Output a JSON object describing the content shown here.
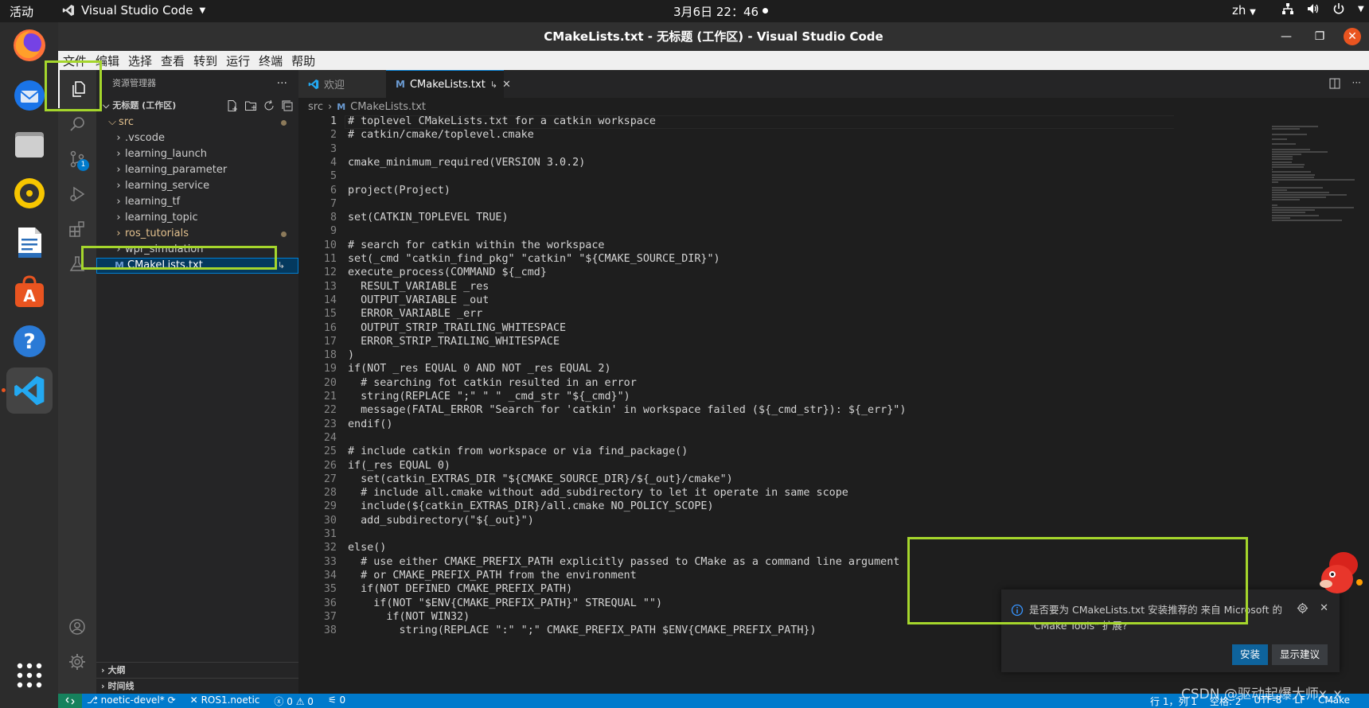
{
  "topbar": {
    "activities": "活动",
    "app_name": "Visual Studio Code",
    "clock": "3月6日  22：46",
    "lang": "zh"
  },
  "window": {
    "title": "CMakeLists.txt - 无标题 (工作区) - Visual Studio Code"
  },
  "menu": [
    "文件",
    "编辑",
    "选择",
    "查看",
    "转到",
    "运行",
    "终端",
    "帮助"
  ],
  "activity_bar": {
    "scm_badge": "1"
  },
  "sidebar": {
    "header": "资源管理器",
    "more": "···",
    "workspace": "无标题 (工作区)",
    "root_folder": "src",
    "items": [
      {
        "label": "src",
        "type": "folder",
        "color": "#e2c08d"
      },
      {
        "label": ".vscode",
        "type": "folder",
        "color": "#cccccc"
      },
      {
        "label": "learning_launch",
        "type": "folder",
        "color": "#cccccc"
      },
      {
        "label": "learning_parameter",
        "type": "folder",
        "color": "#cccccc"
      },
      {
        "label": "learning_service",
        "type": "folder",
        "color": "#cccccc"
      },
      {
        "label": "learning_tf",
        "type": "folder",
        "color": "#cccccc"
      },
      {
        "label": "learning_topic",
        "type": "folder",
        "color": "#cccccc"
      },
      {
        "label": "ros_tutorials",
        "type": "folder",
        "color": "#e2c08d"
      },
      {
        "label": "wpr_simulation",
        "type": "folder",
        "color": "#cccccc"
      },
      {
        "label": "CMakeLists.txt",
        "type": "file",
        "color": "#ffffff"
      }
    ],
    "outline": "大纲",
    "timeline": "时间线"
  },
  "tabs": [
    {
      "label": "欢迎"
    },
    {
      "label": "CMakeLists.txt"
    }
  ],
  "breadcrumb": {
    "folder": "src",
    "file": "CMakeLists.txt"
  },
  "code_lines": [
    "# toplevel CMakeLists.txt for a catkin workspace",
    "# catkin/cmake/toplevel.cmake",
    "",
    "cmake_minimum_required(VERSION 3.0.2)",
    "",
    "project(Project)",
    "",
    "set(CATKIN_TOPLEVEL TRUE)",
    "",
    "# search for catkin within the workspace",
    "set(_cmd \"catkin_find_pkg\" \"catkin\" \"${CMAKE_SOURCE_DIR}\")",
    "execute_process(COMMAND ${_cmd}",
    "  RESULT_VARIABLE _res",
    "  OUTPUT_VARIABLE _out",
    "  ERROR_VARIABLE _err",
    "  OUTPUT_STRIP_TRAILING_WHITESPACE",
    "  ERROR_STRIP_TRAILING_WHITESPACE",
    ")",
    "if(NOT _res EQUAL 0 AND NOT _res EQUAL 2)",
    "  # searching fot catkin resulted in an error",
    "  string(REPLACE \";\" \" \" _cmd_str \"${_cmd}\")",
    "  message(FATAL_ERROR \"Search for 'catkin' in workspace failed (${_cmd_str}): ${_err}\")",
    "endif()",
    "",
    "# include catkin from workspace or via find_package()",
    "if(_res EQUAL 0)",
    "  set(catkin_EXTRAS_DIR \"${CMAKE_SOURCE_DIR}/${_out}/cmake\")",
    "  # include all.cmake without add_subdirectory to let it operate in same scope",
    "  include(${catkin_EXTRAS_DIR}/all.cmake NO_POLICY_SCOPE)",
    "  add_subdirectory(\"${_out}\")",
    "",
    "else()",
    "  # use either CMAKE_PREFIX_PATH explicitly passed to CMake as a command line argument",
    "  # or CMAKE_PREFIX_PATH from the environment",
    "  if(NOT DEFINED CMAKE_PREFIX_PATH)",
    "    if(NOT \"$ENV{CMAKE_PREFIX_PATH}\" STREQUAL \"\")",
    "      if(NOT WIN32)",
    "        string(REPLACE \":\" \";\" CMAKE_PREFIX_PATH $ENV{CMAKE_PREFIX_PATH})"
  ],
  "status": {
    "branch": "noetic-devel*",
    "ros": "ROS1.noetic",
    "errors": "0",
    "warnings": "0",
    "ports": "0",
    "position": "行 1，列 1",
    "spaces": "空格: 2",
    "encoding": "UTF-8",
    "eol": "LF",
    "lang": "CMake"
  },
  "notification": {
    "message_line1": "是否要为 CMakeLists.txt 安装推荐的 来自 Microsoft 的",
    "message_line2": "\"CMake Tools\" 扩展?",
    "install": "安装",
    "suggestions": "显示建议"
  },
  "watermark": "CSDN @驱动起爆大师x_x",
  "colors": {
    "accent": "#007acc",
    "highlight": "#a5d62c",
    "ubuntu_orange": "#e95420",
    "remote": "#16825d"
  }
}
